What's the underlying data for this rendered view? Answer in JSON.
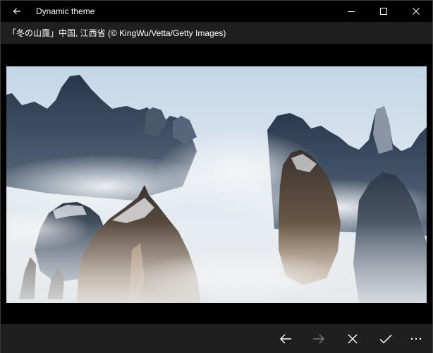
{
  "window": {
    "title": "Dynamic theme",
    "back_icon": "back-arrow-icon",
    "minimize_icon": "minimize-icon",
    "maximize_icon": "maximize-icon",
    "close_icon": "close-icon"
  },
  "caption": {
    "text": "「冬の山靄」中国, 江西省 (© KingWu/Vetta/Getty Images)"
  },
  "image": {
    "subject": "misty-mountain-landscape"
  },
  "commands": {
    "previous_icon": "arrow-left-icon",
    "next_icon": "arrow-right-icon",
    "next_enabled": false,
    "reject_icon": "x-icon",
    "accept_icon": "checkmark-icon",
    "more_icon": "more-ellipsis-icon"
  },
  "colors": {
    "chrome_bg": "#000000",
    "bar_bg": "#1f1f1f",
    "foreground": "#ffffff",
    "disabled": "#7a7a7a"
  }
}
